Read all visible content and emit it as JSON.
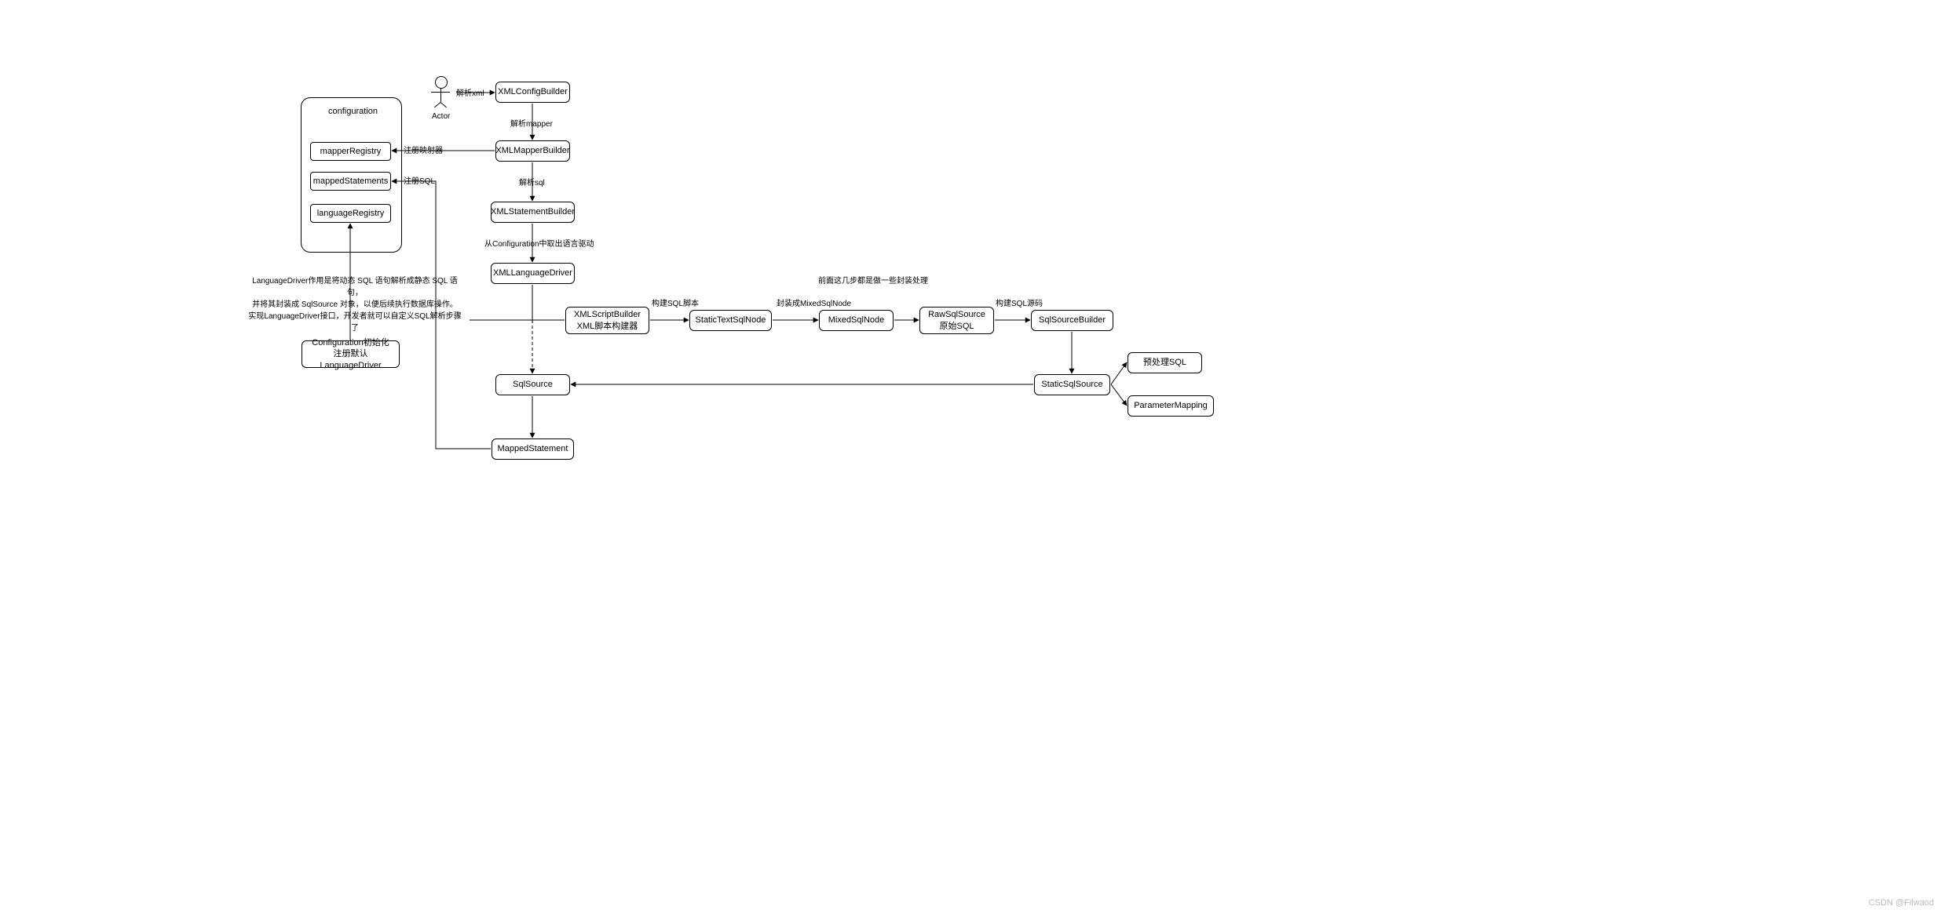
{
  "watermark": "CSDN @Filwaod",
  "actor": {
    "label": "Actor"
  },
  "config": {
    "title": "configuration",
    "cells": {
      "mapperRegistry": "mapperRegistry",
      "mappedStatements": "mappedStatements",
      "languageRegistry": "languageRegistry"
    }
  },
  "nodes": {
    "xmlConfigBuilder": "XMLConfigBuilder",
    "xmlMapperBuilder": "XMLMapperBuilder",
    "xmlStatementBuilder": "XMLStatementBuilder",
    "xmlLanguageDriver": "XMLLanguageDriver",
    "xmlScriptBuilder_l1": "XMLScriptBuilder",
    "xmlScriptBuilder_l2": "XML脚本构建器",
    "staticTextSqlNode": "StaticTextSqlNode",
    "mixedSqlNode": "MixedSqlNode",
    "rawSqlSource_l1": "RawSqlSource",
    "rawSqlSource_l2": "原始SQL",
    "sqlSourceBuilder": "SqlSourceBuilder",
    "staticSqlSource": "StaticSqlSource",
    "preprocessSql": "预处理SQL",
    "parameterMapping": "ParameterMapping",
    "sqlSource": "SqlSource",
    "mappedStatement": "MappedStatement",
    "configInitBox_l1": "Configuration初始化",
    "configInitBox_l2": "注册默认LanguageDriver"
  },
  "edges": {
    "actorToConfig": "解析xml",
    "configToMapper": "解析mapper",
    "mapperToCfgRegistry": "注册映射器",
    "mapperToStatement": "解析sql",
    "mappedStmtToCfg": "注册SQL",
    "stmtToLangDriver": "从Configuration中取出语言驱动",
    "scriptToStaticText": "构建SQL脚本",
    "staticTextToMixed": "封装成MixedSqlNode",
    "rawToSqlBuilder": "构建SQL源码"
  },
  "annotations": {
    "languageDriverNote_l1": "LanguageDriver作用是将动态 SQL 语句解析成静态 SQL 语句，",
    "languageDriverNote_l2": "并将其封装成 SqlSource 对象，以便后续执行数据库操作。",
    "languageDriverNote_l3": "实现LanguageDriver接口，开发者就可以自定义SQL解析步骤了",
    "wrapNote": "前面这几步都是做一些封装处理"
  }
}
